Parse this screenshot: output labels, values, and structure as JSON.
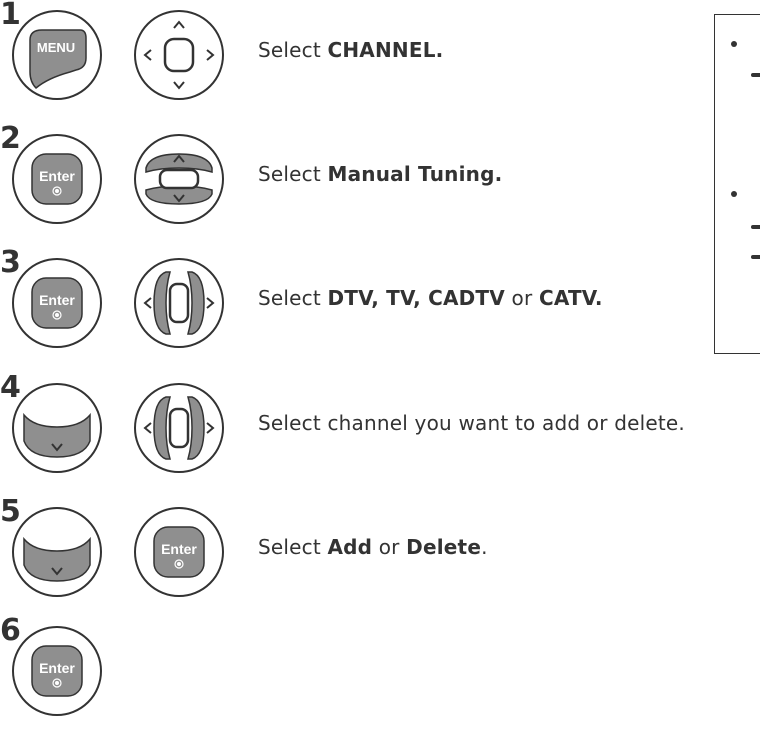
{
  "steps": [
    {
      "number": "1",
      "buttons": [
        {
          "label": "MENU",
          "kind": "menu"
        },
        {
          "label": "",
          "kind": "dpad-all"
        }
      ],
      "parts": [
        {
          "text": "Select ",
          "bold": false
        },
        {
          "text": "CHANNEL.",
          "bold": true
        }
      ]
    },
    {
      "number": "2",
      "buttons": [
        {
          "label": "Enter",
          "kind": "enter"
        },
        {
          "label": "",
          "kind": "dpad-ud"
        }
      ],
      "parts": [
        {
          "text": "Select ",
          "bold": false
        },
        {
          "text": "Manual Tuning.",
          "bold": true
        }
      ]
    },
    {
      "number": "3",
      "buttons": [
        {
          "label": "Enter",
          "kind": "enter"
        },
        {
          "label": "",
          "kind": "dpad-lr"
        }
      ],
      "parts": [
        {
          "text": "Select ",
          "bold": false
        },
        {
          "text": "DTV, TV, CADTV",
          "bold": true
        },
        {
          "text": " or ",
          "bold": false
        },
        {
          "text": "CATV.",
          "bold": true
        }
      ]
    },
    {
      "number": "4",
      "buttons": [
        {
          "label": "",
          "kind": "dpad-down"
        },
        {
          "label": "",
          "kind": "dpad-lr"
        }
      ],
      "parts": [
        {
          "text": "Select channel you want to add or delete.",
          "bold": false
        }
      ]
    },
    {
      "number": "5",
      "buttons": [
        {
          "label": "",
          "kind": "dpad-down"
        },
        {
          "label": "Enter",
          "kind": "enter"
        }
      ],
      "parts": [
        {
          "text": "Select ",
          "bold": false
        },
        {
          "text": "Add",
          "bold": true
        },
        {
          "text": " or ",
          "bold": false
        },
        {
          "text": "Delete",
          "bold": true
        },
        {
          "text": ".",
          "bold": false
        }
      ]
    },
    {
      "number": "6",
      "buttons": [
        {
          "label": "Enter",
          "kind": "enter"
        }
      ],
      "parts": []
    }
  ],
  "colors": {
    "button_fill": "#8f8f8f",
    "button_stroke": "#333333",
    "text": "#333333"
  }
}
